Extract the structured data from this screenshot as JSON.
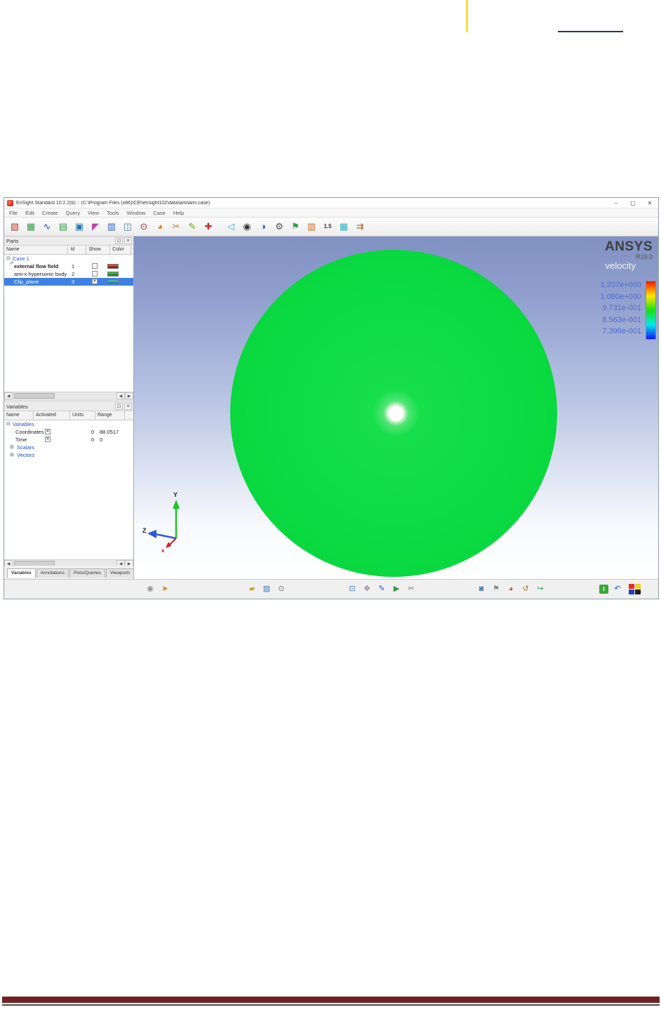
{
  "document": {
    "margin_marker_color": "#f0e33c",
    "link_underline_color": "#1f3864",
    "footer_bar_color": "#702222"
  },
  "window": {
    "title": "EnSight Standard 10.2.2(b) ::  (C:\\Program Files (x86)\\CEI\\ensight102\\data\\ami\\ami.case)",
    "min": "–",
    "max": "▢",
    "close": "✕"
  },
  "menu": {
    "items": [
      "File",
      "Edit",
      "Create",
      "Query",
      "View",
      "Tools",
      "Window",
      "Case",
      "Help"
    ]
  },
  "glyphs": {
    "collapse": "⊟",
    "expand": "⊞",
    "check": "✕",
    "float": "⊡",
    "close": "✕",
    "left": "◀",
    "right": "▶"
  },
  "toolbar": {
    "group1": [
      {
        "name": "parts-manager-icon",
        "glyph": "▧"
      },
      {
        "name": "spreadsheet-icon",
        "glyph": "▦"
      },
      {
        "name": "plot-icon",
        "glyph": "∿"
      },
      {
        "name": "calculator-icon",
        "glyph": "▤"
      },
      {
        "name": "image-icon",
        "glyph": "▣"
      },
      {
        "name": "annotation-icon",
        "glyph": "◤"
      },
      {
        "name": "flipbook-icon",
        "glyph": "▥"
      },
      {
        "name": "camera-icon",
        "glyph": "◫"
      },
      {
        "name": "zoom-icon",
        "glyph": "⊙"
      },
      {
        "name": "color-palette-icon",
        "glyph": "◕"
      },
      {
        "name": "clip-scissors-icon",
        "glyph": "✂"
      },
      {
        "name": "pencil-icon",
        "glyph": "✎"
      },
      {
        "name": "tools-icon",
        "glyph": "✚"
      }
    ],
    "group2": [
      {
        "name": "ruler-icon",
        "glyph": "◁"
      },
      {
        "name": "eye-icon",
        "glyph": "◉"
      },
      {
        "name": "sphere-icon",
        "glyph": "◑"
      },
      {
        "name": "gear-icon",
        "glyph": "⚙"
      },
      {
        "name": "flag-icon",
        "glyph": "⚑"
      },
      {
        "name": "chart-icon",
        "glyph": "▥"
      },
      {
        "name": "timestep-icon",
        "glyph": "1.5"
      },
      {
        "name": "grid-icon",
        "glyph": "▦"
      },
      {
        "name": "export-icon",
        "glyph": "⇉"
      }
    ]
  },
  "parts": {
    "title": "Parts",
    "columns": [
      "Name",
      "Id",
      "Show",
      "Color"
    ],
    "case_label": "Case 1",
    "rows": [
      {
        "prefix": "P",
        "name": "external flow field",
        "id": "1"
      },
      {
        "prefix": "",
        "name": "ami-x hypersonic body",
        "id": "2"
      },
      {
        "prefix": "",
        "name": "Clip_plane",
        "id": "3"
      }
    ]
  },
  "variables": {
    "title": "Variables",
    "columns": [
      "Name",
      "Activated",
      "Units",
      "Range"
    ],
    "root": "Variables",
    "rows": [
      {
        "name": "Coordinates",
        "min": "0",
        "max": "88.0517"
      },
      {
        "name": "Time",
        "min": "0",
        "max": "0"
      }
    ],
    "groups": [
      "Scalars",
      "Vectors"
    ]
  },
  "tabs": [
    "Variables",
    "Annotations",
    "Plots/Queries",
    "Viewports"
  ],
  "viewport": {
    "brand": "ANSYS",
    "release": "R19.0",
    "legend_title": "velocity",
    "legend_values": [
      "1.207e+000",
      "1.090e+000",
      "9.731e-001",
      "8.563e-001",
      "7.396e-001"
    ],
    "legend_colors": [
      "#ff1500",
      "#ffe700",
      "#17e317",
      "#00e9e9",
      "#1414ff"
    ],
    "surface_color": "#0bda41",
    "axes": {
      "y": "Y",
      "z": "Z",
      "x": "x"
    }
  },
  "statusbar": {
    "a": [
      {
        "name": "record-icon",
        "glyph": "◉"
      },
      {
        "name": "pointer-icon",
        "glyph": "➤"
      }
    ],
    "b": [
      {
        "name": "folder-icon",
        "glyph": "▰"
      },
      {
        "name": "select-box-icon",
        "glyph": "▧"
      },
      {
        "name": "magnifier-icon",
        "glyph": "⊙"
      }
    ],
    "c": [
      {
        "name": "zoom-region-icon",
        "glyph": "⊡"
      },
      {
        "name": "transform-icon",
        "glyph": "✥"
      },
      {
        "name": "draw-icon",
        "glyph": "✎"
      },
      {
        "name": "play-icon",
        "glyph": "▶"
      },
      {
        "name": "cut-icon",
        "glyph": "✂"
      }
    ],
    "d": [
      {
        "name": "frame-icon",
        "glyph": "◙"
      },
      {
        "name": "flag-small-icon",
        "glyph": "⚑"
      },
      {
        "name": "palette-small-icon",
        "glyph": "◕"
      },
      {
        "name": "reset-icon",
        "glyph": "↺"
      },
      {
        "name": "redo-icon",
        "glyph": "↪"
      }
    ],
    "e": [
      {
        "name": "info-icon",
        "glyph": "i"
      },
      {
        "name": "undo-icon",
        "glyph": "↶"
      }
    ]
  }
}
